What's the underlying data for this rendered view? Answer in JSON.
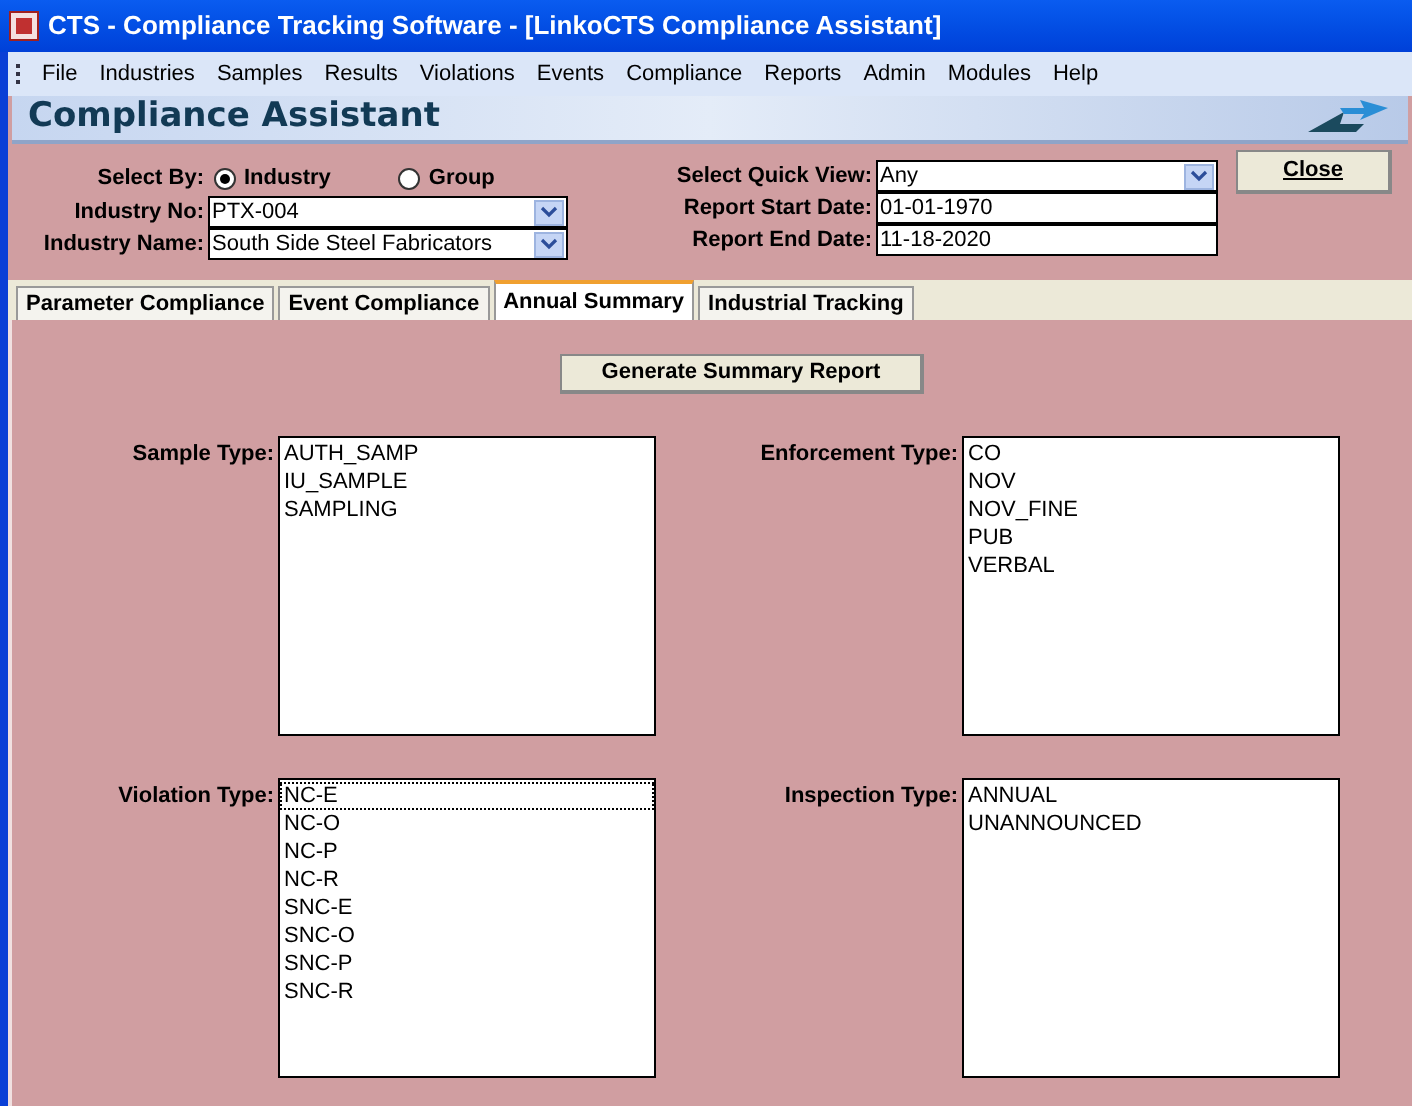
{
  "window": {
    "title": "CTS - Compliance Tracking Software - [LinkoCTS Compliance Assistant]"
  },
  "menu": [
    "File",
    "Industries",
    "Samples",
    "Results",
    "Violations",
    "Events",
    "Compliance",
    "Reports",
    "Admin",
    "Modules",
    "Help"
  ],
  "header": {
    "title": "Compliance Assistant"
  },
  "form": {
    "select_by_label": "Select By:",
    "select_by": [
      {
        "label": "Industry",
        "selected": true
      },
      {
        "label": "Group",
        "selected": false
      }
    ],
    "industry_no": {
      "label": "Industry No:",
      "value": "PTX-004"
    },
    "industry_name": {
      "label": "Industry Name:",
      "value": "South Side Steel Fabricators"
    },
    "quick_view": {
      "label": "Select Quick View:",
      "value": "Any"
    },
    "start_date": {
      "label": "Report Start Date:",
      "value": "01-01-1970"
    },
    "end_date": {
      "label": "Report End Date:",
      "value": "11-18-2020"
    },
    "close_button": "Close"
  },
  "tabs": [
    {
      "label": "Parameter Compliance",
      "selected": false
    },
    {
      "label": "Event Compliance",
      "selected": false
    },
    {
      "label": "Annual Summary",
      "selected": true
    },
    {
      "label": "Industrial Tracking",
      "selected": false
    }
  ],
  "generate_button": "Generate Summary Report",
  "lists": [
    {
      "label": "Sample Type:",
      "items": [
        {
          "text": "AUTH_SAMP",
          "focused": false
        },
        {
          "text": "IU_SAMPLE",
          "focused": false
        },
        {
          "text": "SAMPLING",
          "focused": false
        }
      ]
    },
    {
      "label": "Enforcement Type:",
      "items": [
        {
          "text": "CO",
          "focused": false
        },
        {
          "text": "NOV",
          "focused": false
        },
        {
          "text": "NOV_FINE",
          "focused": false
        },
        {
          "text": "PUB",
          "focused": false
        },
        {
          "text": "VERBAL",
          "focused": false
        }
      ]
    },
    {
      "label": "Violation Type:",
      "items": [
        {
          "text": "NC-E",
          "focused": true
        },
        {
          "text": "NC-O",
          "focused": false
        },
        {
          "text": "NC-P",
          "focused": false
        },
        {
          "text": "NC-R",
          "focused": false
        },
        {
          "text": "SNC-E",
          "focused": false
        },
        {
          "text": "SNC-O",
          "focused": false
        },
        {
          "text": "SNC-P",
          "focused": false
        },
        {
          "text": "SNC-R",
          "focused": false
        }
      ]
    },
    {
      "label": "Inspection Type:",
      "items": [
        {
          "text": "ANNUAL",
          "focused": false
        },
        {
          "text": "UNANNOUNCED",
          "focused": false
        }
      ]
    }
  ]
}
